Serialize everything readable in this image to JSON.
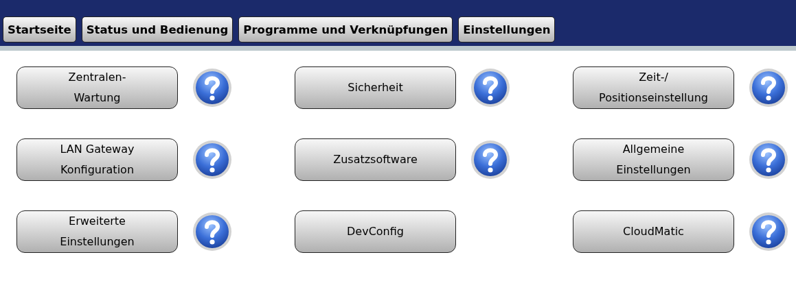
{
  "nav": [
    {
      "label": "Startseite"
    },
    {
      "label": "Status und Bedienung"
    },
    {
      "label": "Programme und Verknüpfungen"
    },
    {
      "label": "Einstellungen"
    }
  ],
  "settings": [
    {
      "label": "Zentralen-\nWartung",
      "help": true
    },
    {
      "label": "Sicherheit",
      "help": true
    },
    {
      "label": "Zeit-/\nPositionseinstellung",
      "help": true
    },
    {
      "label": "LAN Gateway\nKonfiguration",
      "help": true
    },
    {
      "label": "Zusatzsoftware",
      "help": true
    },
    {
      "label": "Allgemeine\nEinstellungen",
      "help": true
    },
    {
      "label": "Erweiterte\nEinstellungen",
      "help": true
    },
    {
      "label": "DevConfig",
      "help": false
    },
    {
      "label": "CloudMatic",
      "help": true
    }
  ]
}
